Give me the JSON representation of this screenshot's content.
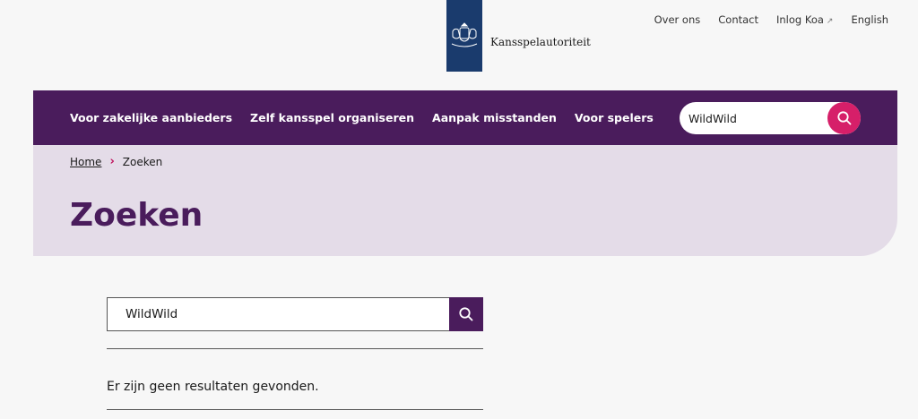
{
  "header": {
    "logo_text": "Kansspelautoriteit",
    "utility_nav": [
      {
        "label": "Over ons"
      },
      {
        "label": "Contact"
      },
      {
        "label": "Inlog Koa",
        "external_icon": "external-link-icon"
      },
      {
        "label": "English"
      }
    ]
  },
  "main_nav": {
    "items": [
      {
        "label": "Voor zakelijke aanbieders"
      },
      {
        "label": "Zelf kansspel organiseren"
      },
      {
        "label": "Aanpak misstanden"
      },
      {
        "label": "Voor spelers"
      }
    ],
    "search_value": "WildWild"
  },
  "breadcrumb": {
    "home": "Home",
    "current": "Zoeken"
  },
  "page": {
    "title": "Zoeken",
    "search_value": "WildWild",
    "no_results": "Er zijn geen resultaten gevonden."
  },
  "colors": {
    "brand_purple": "#4a1c5c",
    "accent_pink": "#d61f69",
    "logo_blue": "#1a3b6d",
    "hero_bg": "#e4dce8"
  }
}
